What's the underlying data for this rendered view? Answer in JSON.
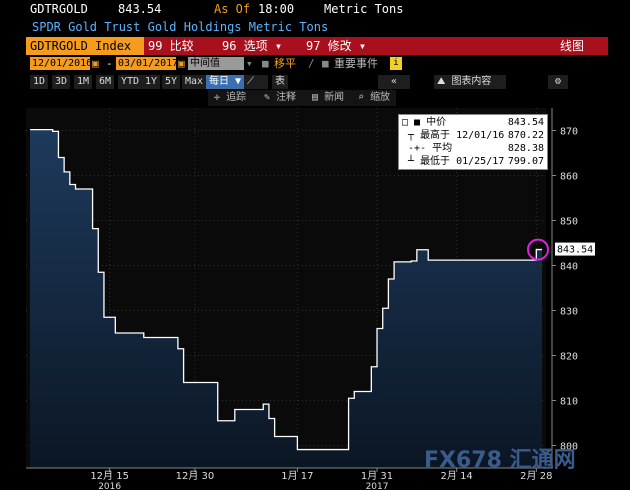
{
  "header": {
    "ticker": "GDTRGOLD",
    "price": "843.54",
    "as_of_label": "As Of",
    "as_of_time": "18:00",
    "unit": "Metric Tons",
    "description": "SPDR Gold Trust Gold Holdings Metric Tons"
  },
  "toolbar": {
    "security": "GDTRGOLD Index",
    "compare_label": "99 比较",
    "options_label": "96 选项",
    "edit_label": "97 修改",
    "chart_type_label": "线图"
  },
  "range": {
    "start_date": "12/01/2016",
    "separator": "-",
    "end_date": "03/01/2017",
    "field": "中间值",
    "move_label": "移平",
    "events_label": "重要事件"
  },
  "periods": [
    "1D",
    "3D",
    "1M",
    "6M",
    "YTD",
    "1Y",
    "5Y",
    "Max"
  ],
  "frequency": "每日",
  "table_label": "表",
  "chart_content_label": "图表内容",
  "chart_tools": {
    "track": "追踪",
    "annotate": "注释",
    "news": "新闻",
    "zoom": "缩放"
  },
  "legend": {
    "series": "中价",
    "series_value": "843.54",
    "high_label": "最高于",
    "high_date": "12/01/16",
    "high_value": "870.22",
    "avg_label": "平均",
    "avg_value": "828.38",
    "low_label": "最低于",
    "low_date": "01/25/17",
    "low_value": "799.07"
  },
  "watermark": "FX678 汇通网",
  "colors": {
    "accent_orange": "#f39c1e",
    "toolbar_red": "#a8101e",
    "title_blue": "#5ab4ff",
    "area_top": "#1d3a5c",
    "area_bottom": "#0b1624",
    "line": "#ffffff",
    "marker": "#e020e0"
  },
  "chart_data": {
    "type": "area",
    "x": [
      "2016-12-01",
      "2016-12-02",
      "2016-12-05",
      "2016-12-06",
      "2016-12-07",
      "2016-12-08",
      "2016-12-09",
      "2016-12-12",
      "2016-12-13",
      "2016-12-14",
      "2016-12-15",
      "2016-12-16",
      "2016-12-19",
      "2016-12-20",
      "2016-12-21",
      "2016-12-22",
      "2016-12-23",
      "2016-12-27",
      "2016-12-28",
      "2016-12-29",
      "2016-12-30",
      "2017-01-03",
      "2017-01-04",
      "2017-01-05",
      "2017-01-06",
      "2017-01-09",
      "2017-01-10",
      "2017-01-11",
      "2017-01-12",
      "2017-01-13",
      "2017-01-17",
      "2017-01-18",
      "2017-01-19",
      "2017-01-20",
      "2017-01-23",
      "2017-01-24",
      "2017-01-25",
      "2017-01-26",
      "2017-01-27",
      "2017-01-30",
      "2017-01-31",
      "2017-02-01",
      "2017-02-02",
      "2017-02-03",
      "2017-02-06",
      "2017-02-07",
      "2017-02-08",
      "2017-02-09",
      "2017-02-10",
      "2017-02-13",
      "2017-02-14",
      "2017-02-15",
      "2017-02-16",
      "2017-02-17",
      "2017-02-21",
      "2017-02-22",
      "2017-02-23",
      "2017-02-24",
      "2017-02-27",
      "2017-02-28",
      "2017-03-01"
    ],
    "values": [
      870.2,
      870.2,
      869.8,
      864.0,
      860.8,
      858.0,
      857.0,
      848.2,
      838.5,
      828.5,
      828.5,
      825.0,
      825.0,
      825.0,
      824.0,
      824.0,
      824.0,
      821.5,
      814.0,
      814.0,
      814.0,
      805.5,
      805.5,
      805.5,
      808.0,
      808.0,
      808.0,
      809.2,
      806.0,
      802.0,
      799.1,
      799.1,
      799.1,
      799.1,
      799.1,
      799.1,
      799.1,
      810.5,
      812.0,
      817.5,
      826.0,
      830.5,
      837.0,
      840.8,
      841.0,
      843.5,
      843.5,
      841.2,
      841.2,
      841.2,
      841.2,
      841.2,
      841.2,
      841.2,
      841.2,
      841.2,
      841.2,
      841.2,
      841.2,
      843.54,
      843.54
    ],
    "ylim": [
      795,
      875
    ],
    "yticks": [
      800,
      810,
      820,
      830,
      840,
      850,
      860,
      870
    ],
    "xticks": [
      {
        "date": "2016-12-15",
        "label": "12月 15"
      },
      {
        "date": "2016-12-30",
        "label": "12月 30"
      },
      {
        "date": "2017-01-17",
        "label": "1月 17"
      },
      {
        "date": "2017-01-31",
        "label": "1月 31"
      },
      {
        "date": "2017-02-14",
        "label": "2月 14"
      },
      {
        "date": "2017-02-28",
        "label": "2月 28"
      }
    ],
    "year_labels": [
      {
        "date": "2016-12-15",
        "label": "2016"
      },
      {
        "date": "2017-01-31",
        "label": "2017"
      }
    ],
    "last_value_label": "843.54",
    "grid": true
  }
}
